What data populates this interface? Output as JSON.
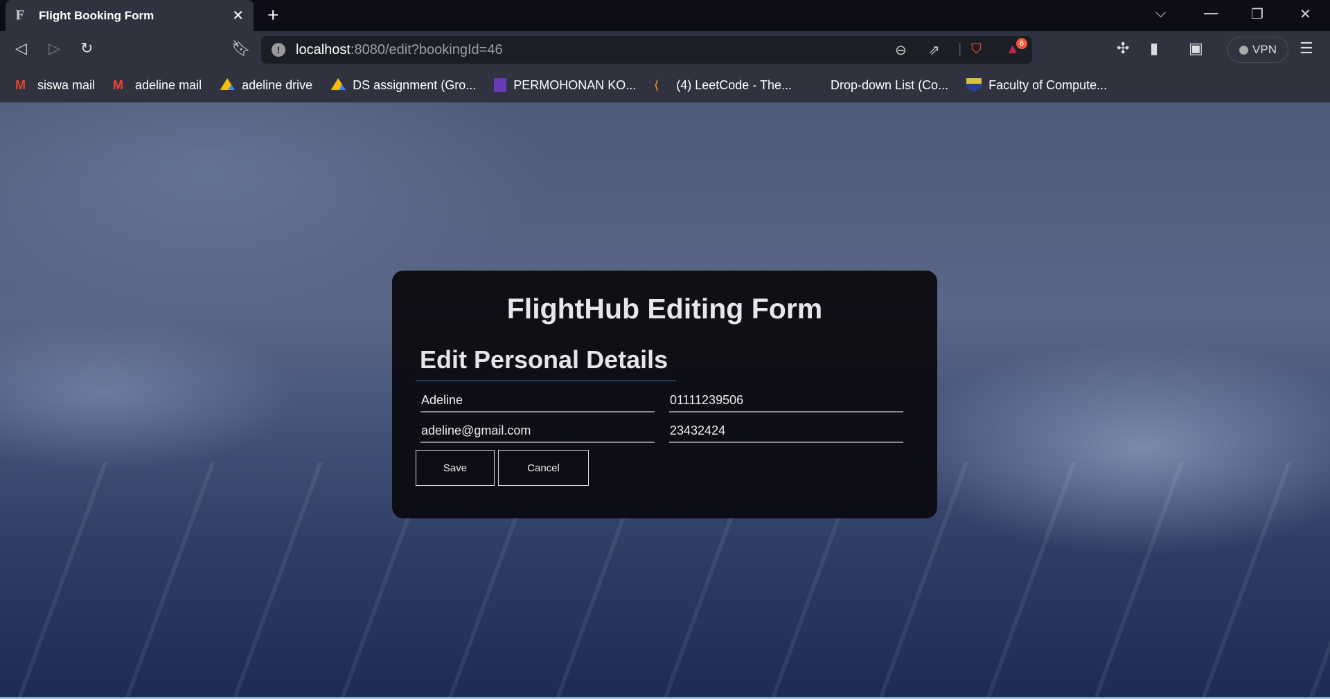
{
  "browser": {
    "tab_title": "Flight Booking Form",
    "url_host": "localhost",
    "url_path": ":8080/edit?bookingId=46",
    "rewards_badge": "6",
    "vpn_label": "VPN",
    "bookmarks": [
      {
        "label": "siswa mail",
        "icon": "gmail-icon",
        "color": "#ea4335"
      },
      {
        "label": "adeline mail",
        "icon": "gmail-icon",
        "color": "#ea4335"
      },
      {
        "label": "adeline drive",
        "icon": "google-drive-icon",
        "color": "#34a853"
      },
      {
        "label": "DS assignment (Gro...",
        "icon": "google-drive-icon",
        "color": "#34a853"
      },
      {
        "label": "PERMOHONAN KO...",
        "icon": "google-forms-icon",
        "color": "#673ab7"
      },
      {
        "label": "(4) LeetCode - The...",
        "icon": "leetcode-icon",
        "color": "#f89f1b"
      },
      {
        "label": "Drop-down List (Co...",
        "icon": "",
        "color": ""
      },
      {
        "label": "Faculty of Compute...",
        "icon": "faculty-crest-icon",
        "color": "#2a3f8f"
      }
    ]
  },
  "form": {
    "title": "FlightHub Editing Form",
    "section_title": "Edit Personal Details",
    "fields": {
      "name": "Adeline",
      "phone": "01111239506",
      "email": "adeline@gmail.com",
      "passport": "23432424"
    },
    "save_label": "Save",
    "cancel_label": "Cancel"
  }
}
